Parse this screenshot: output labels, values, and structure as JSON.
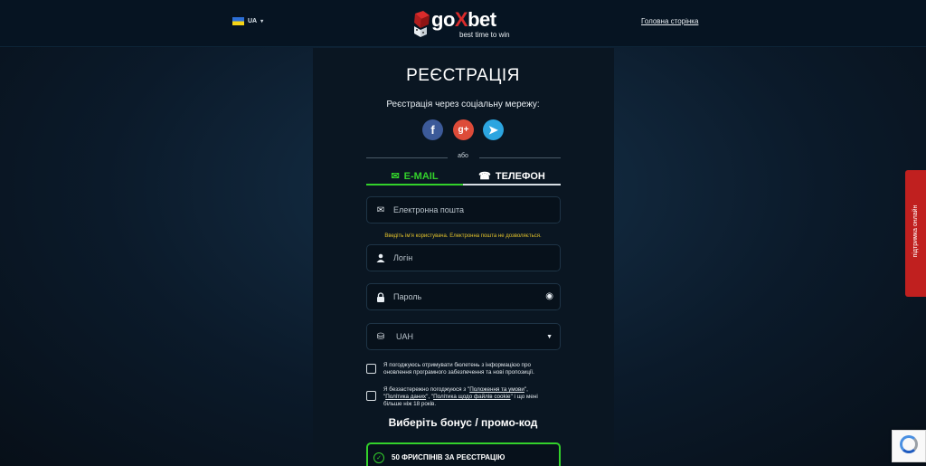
{
  "header": {
    "lang_code": "UA",
    "logo_text_a": "go",
    "logo_text_x": "X",
    "logo_text_b": "bet",
    "logo_tagline": "best time to win",
    "home_link": "Головна сторінка"
  },
  "form": {
    "title": "РЕЄСТРАЦІЯ",
    "social_title": "Реєстрація через соціальну мережу:",
    "social": {
      "facebook": "f",
      "google": "g+",
      "telegram": "➤"
    },
    "or_text": "або",
    "tabs": {
      "email": "E-MAIL",
      "phone": "ТЕЛЕФОН"
    },
    "email_placeholder": "Електронна пошта",
    "hint": "Введіть ім'я користувача. Електронна пошта не дозволяється.",
    "login_placeholder": "Логін",
    "password_placeholder": "Пароль",
    "currency_value": "UAH",
    "consent1": "Я погоджуюсь отримувати бюлетень з інформацією про оновлення програмного забезпечення та нові пропозиції.",
    "consent2_pre": "Я беззастережно погоджуюся з \"",
    "consent2_link1": "Положення та умови",
    "consent2_mid1": "\", \"",
    "consent2_link2": "Політика даних",
    "consent2_mid2": "\", \"",
    "consent2_link3": "Політика щодо файлів cookie",
    "consent2_post": "\" і що мені більше ніж 18 років.",
    "bonus_title": "Виберіть бонус / промо-код",
    "bonus_option": "50 ФРИСПІНІВ ЗА РЕЄСТРАЦІЮ"
  },
  "support_label": "підтримка онлайн",
  "colors": {
    "accent": "#33d12b",
    "support": "#c0201f",
    "warning": "#e3c22b"
  }
}
